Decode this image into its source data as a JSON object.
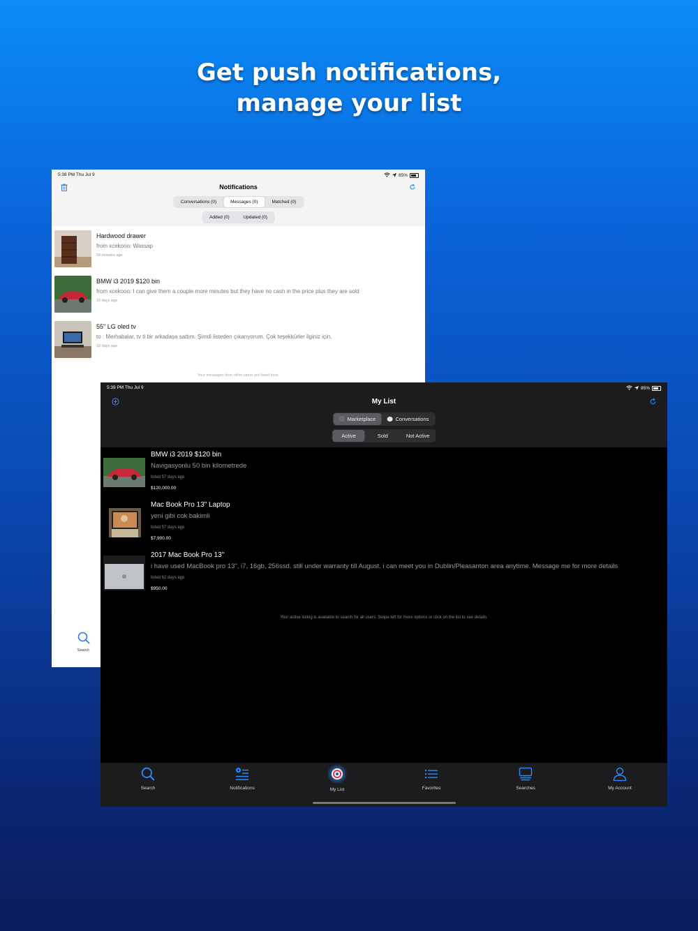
{
  "headline": {
    "line1": "Get push notifications,",
    "line2": "manage your list"
  },
  "light_screen": {
    "status": {
      "time": "5:38 PM  Thu Jul 9",
      "battery": "85%"
    },
    "title": "Notifications",
    "tabs_top": [
      "Conversations (0)",
      "Messages (0)",
      "Matched (0)"
    ],
    "tabs_top_selected": 1,
    "tabs_bottom": [
      "Added (0)",
      "Updated (0)"
    ],
    "messages": [
      {
        "title": "Hardwood drawer",
        "subtitle": "from xcekooo: Wassap",
        "date": "59 minutes ago"
      },
      {
        "title": "BMW i3 2019 $120 bin",
        "subtitle": "from xcekooo: I can give them a couple more minutes but they have no cash in the price plus they are sold",
        "date": "15 days ago"
      },
      {
        "title": "55\" LG oled tv",
        "subtitle": "to : Merhabalar, tv ti bir arkadaşa sattım. Şimdi listeden çıkarıyorum. Çok teşekkürler ilginiz için.",
        "date": "18 days ago"
      }
    ],
    "footnote": "Your messages from other users are listed here.",
    "tab_search_label": "Search"
  },
  "dark_screen": {
    "status": {
      "time": "5:39 PM  Thu Jul 9",
      "battery": "85%"
    },
    "title": "My List",
    "seg_top": [
      "Marketplace",
      "Conversations"
    ],
    "seg_bottom": [
      "Active",
      "Sold",
      "Not Active"
    ],
    "items": [
      {
        "title": "BMW i3 2019 $120 bin",
        "subtitle": "Navigasyonlu 50 bin kilometrede",
        "date": "listed 57 days ago",
        "price": "$120,000.00"
      },
      {
        "title": "Mac  Book Pro 13\" Laptop",
        "subtitle": "yeni gibi cok bakimli",
        "date": "listed 57 days ago",
        "price": "$7,900.00"
      },
      {
        "title": "2017 Mac Book Pro 13\"",
        "subtitle": "i have used MacBook pro 13\", i7, 16gb, 256ssd. still under warranty till August. i can meet you in Dublin/Pleasanton area anytime. Message me for more details",
        "date": "listed 62 days ago",
        "price": "$950.00"
      }
    ],
    "footnote": "Your active listing is available to search for all users. Swipe left for more options or click on the list to see details.",
    "tabbar": [
      "Search",
      "Notifications",
      "My List",
      "Favorites",
      "Searches",
      "My Account"
    ]
  },
  "colors": {
    "accent": "#2a8cff",
    "bg_top": "#0a8cf7",
    "bg_bottom": "#0a1d5a"
  }
}
